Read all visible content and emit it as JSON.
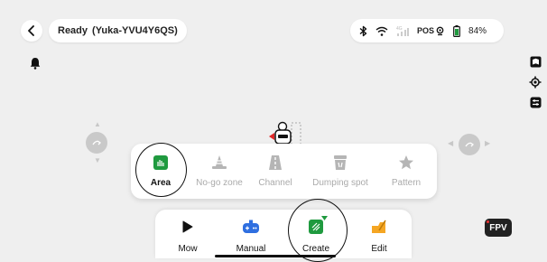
{
  "header": {
    "status": "Ready",
    "device": "(Yuka-YVU4Y6QS)",
    "pos_label": "POS",
    "battery": "84%"
  },
  "icons": {
    "back": "chevron-left-icon",
    "bluetooth": "bluetooth-icon",
    "wifi": "wifi-icon",
    "cellular": "cellular-4g-icon",
    "gps": "gps-icon",
    "battery": "battery-icon",
    "bell": "bell-icon",
    "map": "map-icon",
    "locate": "locate-icon",
    "settings": "settings-icon"
  },
  "submenu": {
    "items": [
      {
        "label": "Area",
        "icon": "area-icon",
        "active": true
      },
      {
        "label": "No-go zone",
        "icon": "no-go-zone-icon",
        "active": false
      },
      {
        "label": "Channel",
        "icon": "channel-icon",
        "active": false
      },
      {
        "label": "Dumping spot",
        "icon": "dumping-spot-icon",
        "active": false
      },
      {
        "label": "Pattern",
        "icon": "pattern-icon",
        "active": false
      }
    ]
  },
  "bottom_bar": {
    "items": [
      {
        "label": "Mow",
        "icon": "mow-play-icon"
      },
      {
        "label": "Manual",
        "icon": "gamepad-icon"
      },
      {
        "label": "Create",
        "icon": "create-icon"
      },
      {
        "label": "Edit",
        "icon": "edit-icon"
      }
    ]
  },
  "fpv_label": "FPV",
  "colors": {
    "accent_green": "#1f9a3f",
    "edit_orange": "#f5a623",
    "manual_blue": "#2f6fe0",
    "background": "#efefef"
  }
}
